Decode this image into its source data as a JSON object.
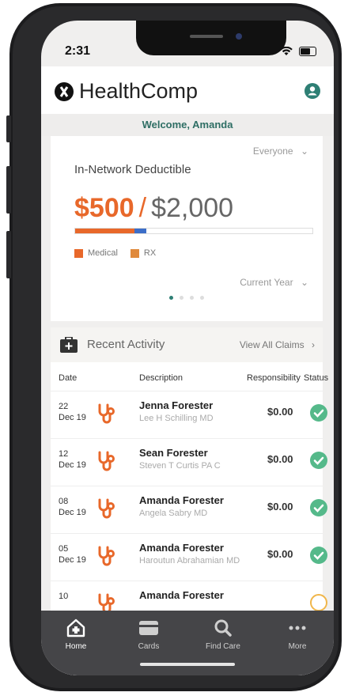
{
  "status_bar": {
    "time": "2:31"
  },
  "app": {
    "name": "HealthComp"
  },
  "welcome": "Welcome, Amanda",
  "deductible": {
    "filter": "Everyone",
    "title": "In-Network Deductible",
    "paid": "$500",
    "separator": "/",
    "total": "$2,000",
    "paid_fraction": 0.25,
    "rx_fraction": 0.05,
    "legend": [
      {
        "label": "Medical",
        "color": "#e8682a"
      },
      {
        "label": "RX",
        "color": "#e08a3c"
      }
    ],
    "period": "Current Year",
    "page_dots": {
      "count": 4,
      "active": 0
    }
  },
  "activity": {
    "title": "Recent Activity",
    "view_all": "View All Claims",
    "columns": {
      "date": "Date",
      "description": "Description",
      "responsibility": "Responsibility",
      "status": "Status"
    },
    "rows": [
      {
        "day": "22",
        "month": "Dec 19",
        "name": "Jenna Forester",
        "provider": "Lee H Schilling MD",
        "amount": "$0.00",
        "status": "approved"
      },
      {
        "day": "12",
        "month": "Dec 19",
        "name": "Sean Forester",
        "provider": "Steven T Curtis PA C",
        "amount": "$0.00",
        "status": "approved"
      },
      {
        "day": "08",
        "month": "Dec 19",
        "name": "Amanda Forester",
        "provider": "Angela Sabry MD",
        "amount": "$0.00",
        "status": "approved"
      },
      {
        "day": "05",
        "month": "Dec 19",
        "name": "Amanda Forester",
        "provider": "Haroutun Abrahamian MD",
        "amount": "$0.00",
        "status": "approved"
      },
      {
        "day": "10",
        "month": "",
        "name": "Amanda Forester",
        "provider": "",
        "amount": "",
        "status": "pending"
      }
    ]
  },
  "tabs": [
    {
      "label": "Home",
      "icon": "home-icon",
      "active": true
    },
    {
      "label": "Cards",
      "icon": "card-icon",
      "active": false
    },
    {
      "label": "Find Care",
      "icon": "search-icon",
      "active": false
    },
    {
      "label": "More",
      "icon": "more-icon",
      "active": false
    }
  ],
  "colors": {
    "accent": "#e8682a",
    "brand_teal": "#2e7f74",
    "approved": "#55b98a",
    "pending": "#f0b64a"
  }
}
